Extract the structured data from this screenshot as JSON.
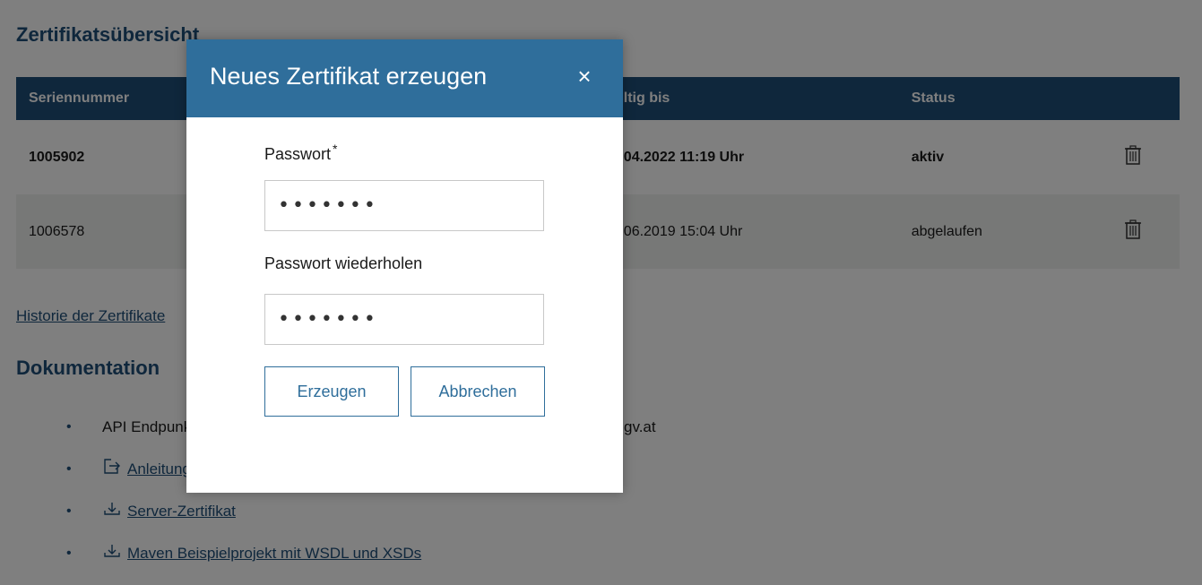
{
  "page": {
    "title": "Zertifikatsübersicht",
    "table": {
      "headers": [
        "Seriennummer",
        "Gültig bis",
        "Status"
      ],
      "rows": [
        {
          "serial": "1005902",
          "valid_until": "19.04.2022 11:19 Uhr",
          "status": "aktiv"
        },
        {
          "serial": "1006578",
          "valid_until": "26.06.2019 15:04 Uhr",
          "status": "abgelaufen"
        }
      ]
    },
    "history_link": "Historie der Zertifikate",
    "doc_title": "Dokumentation",
    "docs": [
      {
        "label": "API Endpunkt",
        "host": "gv.at"
      },
      {
        "label": "Anleitung",
        "icon": "external-link-icon"
      },
      {
        "label": "Server-Zertifikat",
        "icon": "download-icon"
      },
      {
        "label": "Maven Beispielprojekt mit WSDL und XSDs",
        "icon": "download-icon"
      }
    ]
  },
  "modal": {
    "title": "Neues Zertifikat erzeugen",
    "close_symbol": "×",
    "password_label": "Passwort",
    "required_marker": "*",
    "password_value": "1234567",
    "password_repeat_label": "Passwort wiederholen",
    "password_repeat_value": "1234567",
    "create_button": "Erzeugen",
    "cancel_button": "Abbrechen"
  },
  "colors": {
    "brand": "#1f4e79",
    "modal_header": "#2f6e9b"
  }
}
